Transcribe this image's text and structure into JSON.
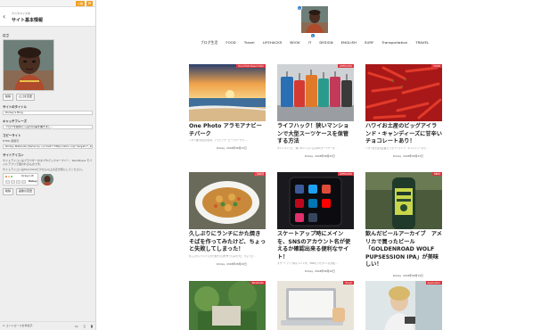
{
  "sidebar": {
    "publish_label": "公開",
    "gear_label": "⚙",
    "crumb": "カスタマイズ中",
    "section_title": "サイト基本情報",
    "logo_label": "ロゴ",
    "logo_buttons": [
      "削除",
      "ロゴを変更"
    ],
    "site_title_label": "サイトのタイトル",
    "site_title_value": "Rickey's Blog",
    "tagline_label": "キャッチフレーズ",
    "tagline_value": "ブログを始めたら自分の事を書きまし...",
    "copyright_label": "コピーライト",
    "copyright_desc": "HTML 使用可",
    "copyright_value": "Rickey Matsuda (Same by <a href=\"https://2inc.org\" target=\"_blan",
    "site_icon_label": "サイトアイコン",
    "site_icon_desc": "サイトアイコンはブラウザーのタブやブックマークバー、WordPress モバイルアプリで使われるものです。",
    "site_icon_desc2": "サイトアイコンは512×512ピクセル以上の正方形にしてください。",
    "mini_name": "Rickey's Bl",
    "mini_name2": "Rickey",
    "icon_buttons": [
      "削除",
      "画像の変更"
    ],
    "hide_controls": "コントロールを非表示",
    "colors": {
      "publish": "#f0a020",
      "accent": "#1e73be",
      "category": "#d9363e"
    }
  },
  "nav": [
    "ブログ生活",
    "FOOD",
    "Travel",
    "LIFEHACKS",
    "BOOK",
    "IT",
    "DESIGN",
    "ENGLISH",
    "SURF",
    "Transportation",
    "TRAVEL"
  ],
  "cards": [
    {
      "title": "One Photo アラモアナビーチパーク",
      "category": "One Photo Beach Park",
      "excerpt": "ハワイ旅行前日のお昼、アラモアナ・ビーチパークで…",
      "author": "Rickey",
      "date": "2018年08月31日"
    },
    {
      "title": "ライフハック！狭いマンションで大型スーツケースを保管する方法",
      "category": "LIFEHACKS",
      "excerpt": "マンションって、狭いマンションには中々スーツケース…",
      "author": "Rickey",
      "date": "2018年08月25日"
    },
    {
      "title": "ハワイお土産のビッグアイランド・キャンディーズに甘辛いチョコレートあり！",
      "category": "FOOD",
      "excerpt": "ハワイお土産の定番 ビッグアイランド・キャンディーズで…",
      "author": "Rickey",
      "date": "2018年08月23日"
    },
    {
      "title": "久しぶりにランチにかた焼きそばを作ってみたけど、ちょっと失敗してしまった！",
      "category": "ご飯料理",
      "excerpt": "久しぶりにランチにかた焼きそばを作ってみたけど、ちょっと…",
      "author": "Rickey",
      "date": "2018年08月20日"
    },
    {
      "title": "スケートアップ時にメインを、SNSのアカウント名が使えるか確認出来る便利なサイト！",
      "category": "LIFEHACKS",
      "excerpt": "スケートアップ時にメインを、SNSのアカウント名が使…",
      "author": "Rickey",
      "date": "2018年08月20日"
    },
    {
      "title": "飲んだビールアーカイブ　アメリカで買ったビール「GOLDENROAD WOLF PUPSESSION IPA」が美味しい！",
      "category": "BEER",
      "excerpt": "",
      "author": "Rickey",
      "date": "2018年08月19日"
    },
    {
      "title": "",
      "category": "Bookmark",
      "excerpt": "",
      "author": "",
      "date": ""
    },
    {
      "title": "",
      "category": "Travel",
      "excerpt": "",
      "author": "",
      "date": ""
    },
    {
      "title": "",
      "category": "Application",
      "excerpt": "",
      "author": "",
      "date": ""
    }
  ]
}
